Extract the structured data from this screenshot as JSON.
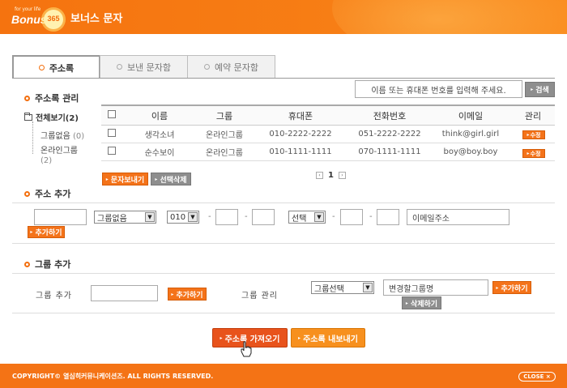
{
  "header": {
    "logo_tagline": "for your life",
    "logo_word": "Bonus",
    "logo_badge": "365",
    "title": "보너스 문자"
  },
  "tabs": [
    {
      "label": "주소록",
      "active": true
    },
    {
      "label": "보낸 문자함",
      "active": false
    },
    {
      "label": "예약 문자함",
      "active": false
    }
  ],
  "address_book": {
    "title": "주소록 관리",
    "search_placeholder": "이름 또는 휴대폰 번호를 입력해 주세요.",
    "search_button": "검색",
    "tree": {
      "root": "전체보기(2)",
      "items": [
        {
          "label": "그룹없음",
          "count": "(0)"
        },
        {
          "label": "온라인그룹",
          "count": "(2)"
        }
      ]
    },
    "table": {
      "headers": [
        "이름",
        "그룹",
        "휴대폰",
        "전화번호",
        "이메일",
        "관리"
      ],
      "rows": [
        {
          "name": "생각소녀",
          "group": "온라인그룹",
          "mobile": "010-2222-2222",
          "phone": "051-2222-2222",
          "email": "think@girl.girl",
          "action": "수정"
        },
        {
          "name": "순수보이",
          "group": "온라인그룹",
          "mobile": "010-1111-1111",
          "phone": "070-1111-1111",
          "email": "boy@boy.boy",
          "action": "수정"
        }
      ]
    },
    "send_button": "문자보내기",
    "delete_button": "선택삭제",
    "pager": {
      "current": "1"
    }
  },
  "address_add": {
    "title": "주소 추가",
    "group_select": "그룹없음",
    "mobile_prefix": "010",
    "phone_prefix": "선택",
    "email_value": "이메일주소",
    "add_button": "추가하기"
  },
  "group_add": {
    "title": "그룹 추가",
    "add_label": "그룹 추가",
    "add_button": "추가하기",
    "manage_label": "그룹 관리",
    "manage_select": "그룹선택",
    "rename_value": "변경할그룹명",
    "rename_button": "추가하기",
    "delete_button": "삭제하기"
  },
  "actions": {
    "import_button": "주소록 가져오기",
    "export_button": "주소록 내보내기"
  },
  "footer": {
    "copyright": "COPYRIGHT© 열심히커뮤니케이션즈. ALL RIGHTS RESERVED.",
    "close_button": "CLOSE ×"
  },
  "colors": {
    "brand_orange": "#f47315",
    "button_gray": "#8e8e8e",
    "import_red": "#e8531c"
  }
}
